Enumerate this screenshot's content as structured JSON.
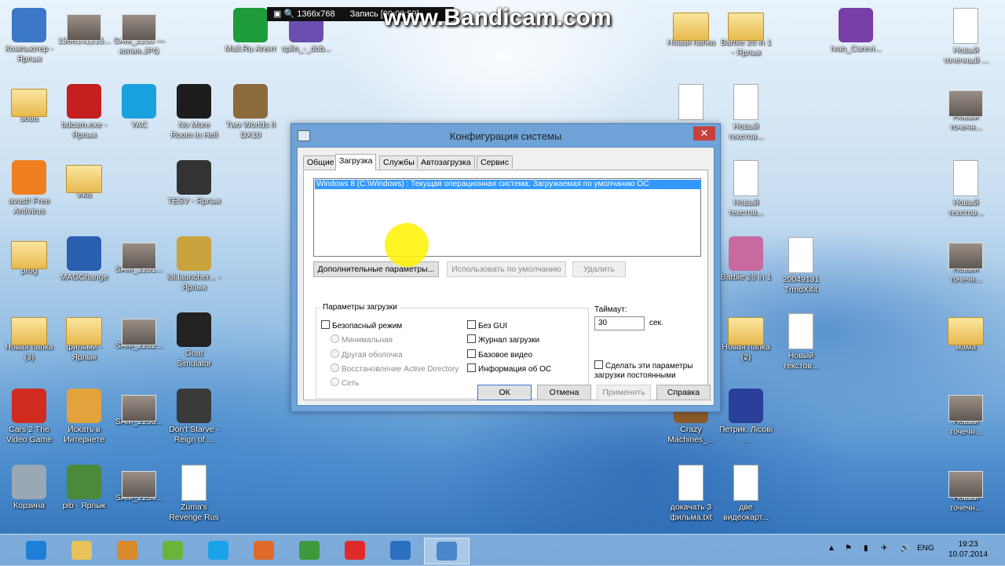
{
  "recorder": {
    "resolution": "1366x768",
    "status": "Запись [00:00:59]",
    "brand": "www.Bandicam.com"
  },
  "desktop_icons": {
    "c1": [
      {
        "label": "Компьютер - Ярлык",
        "type": "app",
        "color": "#3b78c7"
      },
      {
        "label": "вова",
        "type": "folder"
      },
      {
        "label": "avast! Free Antivirus",
        "type": "app",
        "color": "#f07f1f"
      },
      {
        "label": "prog",
        "type": "folder"
      },
      {
        "label": "Новая папка (3)",
        "type": "folder"
      },
      {
        "label": "Cars 2 The Video Game",
        "type": "app",
        "color": "#d22b1f"
      },
      {
        "label": "Корзина",
        "type": "app",
        "color": "#9aa7b4"
      }
    ],
    "c2": [
      {
        "label": "1366141215...",
        "type": "photo"
      },
      {
        "label": "bdcam.exe - Ярлык",
        "type": "app",
        "color": "#c51f1f"
      },
      {
        "label": "vika",
        "type": "folder"
      },
      {
        "label": "MAGChange",
        "type": "app",
        "color": "#2a5fb0"
      },
      {
        "label": "фильми - Ярлык",
        "type": "folder"
      },
      {
        "label": "Искать в Интернете",
        "type": "app",
        "color": "#e3a33c"
      },
      {
        "label": "pib - Ярлык",
        "type": "app",
        "color": "#4b8a3a"
      }
    ],
    "c3": [
      {
        "label": "SAM_2230 — копия.JPG",
        "type": "photo"
      },
      {
        "label": "YAC",
        "type": "app",
        "color": "#1aa1e0"
      },
      {
        "label": "SAM_2231...",
        "type": "photo"
      },
      {
        "label": "SAM_2232...",
        "type": "photo"
      },
      {
        "label": "SAM_2233...",
        "type": "photo"
      },
      {
        "label": "SAM_2234...",
        "type": "photo"
      }
    ],
    "c4": [
      {
        "label": "No More Room in Hell",
        "type": "app",
        "color": "#1d1d1d"
      },
      {
        "label": "TESV - Ярлык",
        "type": "app",
        "color": "#333333"
      },
      {
        "label": "lol.launcher... - Ярлык",
        "type": "app",
        "color": "#c9a33e"
      },
      {
        "label": "Goat Simulator",
        "type": "app",
        "color": "#222222"
      },
      {
        "label": "Don't Starve - Reign of ...",
        "type": "app",
        "color": "#3a3a3a"
      },
      {
        "label": "Zuma's Revenge Rus",
        "type": "doc"
      }
    ],
    "c5": [
      {
        "label": "Mail.Ru Агент",
        "type": "app",
        "color": "#1e9c3a"
      },
      {
        "label": "Two Worlds II DX10",
        "type": "app",
        "color": "#8b6a3b"
      }
    ],
    "c5b": [
      {
        "label": "splin_-_dob...",
        "type": "app",
        "color": "#6a4fb0"
      }
    ],
    "r1": [
      {
        "label": "Новая папка",
        "type": "folder"
      },
      {
        "label": "",
        "type": "doc"
      },
      {
        "label": "",
        "type": "doc"
      },
      {
        "label": "Crazy Machines_...",
        "type": "app",
        "color": "#8b5a2b"
      },
      {
        "label": "докачать 3 фильма.txt",
        "type": "doc"
      }
    ],
    "r2": [
      {
        "label": "Barbie 26 in 1 - Ярлык",
        "type": "folder"
      },
      {
        "label": "Новый текстов...",
        "type": "doc"
      },
      {
        "label": "Новый текстов...",
        "type": "doc"
      },
      {
        "label": "Barbie 26 in 1",
        "type": "app",
        "color": "#c86aa0"
      },
      {
        "label": "Новая папка (2)",
        "type": "folder"
      },
      {
        "label": "Петрик. Лісові ...",
        "type": "app",
        "color": "#2a3f9a"
      },
      {
        "label": "две видеокарт...",
        "type": "doc"
      }
    ],
    "r3": [
      {
        "label": "20049131 TrmoX4it",
        "type": "doc"
      },
      {
        "label": "Новый текстов...",
        "type": "doc"
      }
    ],
    "r4": [
      {
        "label": "Ivan_Carevi...",
        "type": "app",
        "color": "#7a3fa6"
      }
    ],
    "r5": [
      {
        "label": "Новый точечный ...",
        "type": "doc"
      },
      {
        "label": "Новый точечн...",
        "type": "photo"
      },
      {
        "label": "Новый текстов...",
        "type": "doc"
      },
      {
        "label": "Новый точечн...",
        "type": "photo"
      },
      {
        "label": "мама",
        "type": "folder"
      },
      {
        "label": "Новый точечн...",
        "type": "photo"
      },
      {
        "label": "Новый точечн...",
        "type": "photo"
      }
    ]
  },
  "dialog": {
    "title": "Конфигурация системы",
    "tabs": [
      "Общие",
      "Загрузка",
      "Службы",
      "Автозагрузка",
      "Сервис"
    ],
    "active_tab": "Загрузка",
    "os_entry": "Windows 8 (C:\\Windows) : Текущая операционная система; Загружаемая по умолчанию ОС",
    "buttons": {
      "advanced": "Дополнительные параметры...",
      "set_default": "Использовать по умолчанию",
      "delete": "Удалить"
    },
    "boot_options": {
      "legend": "Параметры загрузки",
      "safe_boot": "Безопасный режим",
      "minimal": "Минимальная",
      "alt_shell": "Другая оболочка",
      "ad_repair": "Восстановление Active Directory",
      "network": "Сеть",
      "no_gui": "Без GUI",
      "boot_log": "Журнал загрузки",
      "base_video": "Базовое видео",
      "os_info": "Информация  об ОС"
    },
    "timeout": {
      "label": "Таймаут:",
      "value": "30",
      "unit": "сек."
    },
    "permanent": "Сделать эти параметры загрузки постоянными",
    "footer": {
      "ok": "ОК",
      "cancel": "Отмена",
      "apply": "Применить",
      "help": "Справка"
    }
  },
  "taskbar": {
    "apps": [
      {
        "name": "ie",
        "color": "#1e7fd8"
      },
      {
        "name": "explorer",
        "color": "#e9c25a"
      },
      {
        "name": "media",
        "color": "#d98a2b"
      },
      {
        "name": "utorrent",
        "color": "#6bb33a"
      },
      {
        "name": "skype",
        "color": "#1aa3e8"
      },
      {
        "name": "player",
        "color": "#e06a2a"
      },
      {
        "name": "chrome",
        "color": "#3c9a3c"
      },
      {
        "name": "yandex",
        "color": "#e02a2a"
      },
      {
        "name": "movie",
        "color": "#2a6fc0"
      },
      {
        "name": "msconfig",
        "color": "#4a86c8"
      }
    ],
    "lang": "ENG",
    "time": "19:23",
    "date": "10.07.2014"
  }
}
